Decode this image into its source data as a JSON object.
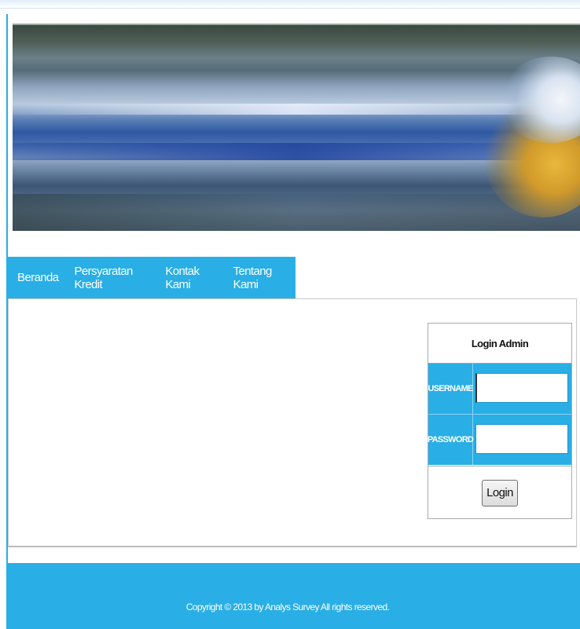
{
  "nav": {
    "items": [
      {
        "label": "Beranda"
      },
      {
        "label": "Persyaratan Kredit"
      },
      {
        "label": "Kontak Kami"
      },
      {
        "label": "Tentang Kami"
      }
    ]
  },
  "login": {
    "title": "Login Admin",
    "username_label": "USERNAME",
    "username_value": "",
    "password_label": "PASSWORD",
    "password_value": "",
    "button_label": "Login"
  },
  "footer": {
    "text": "Copyright © 2013 by Analys Survey All rights reserved."
  },
  "colors": {
    "accent": "#29aee6"
  }
}
